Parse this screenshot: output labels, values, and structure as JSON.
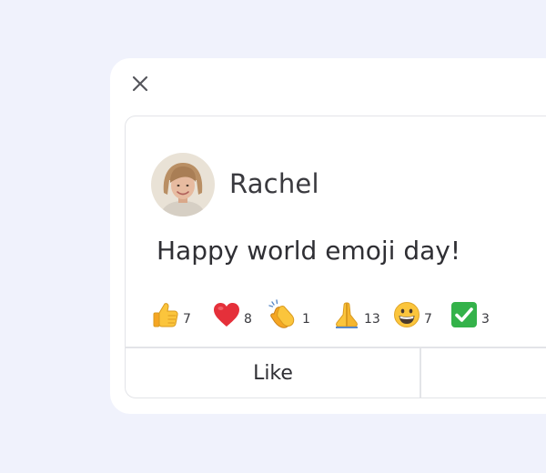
{
  "post": {
    "author": "Rachel",
    "message": "Happy world emoji day!"
  },
  "reactions": [
    {
      "emoji": "thumbs-up",
      "count": "7"
    },
    {
      "emoji": "red-heart",
      "count": "8"
    },
    {
      "emoji": "clapping-hands",
      "count": "1"
    },
    {
      "emoji": "folded-hands",
      "count": "13"
    },
    {
      "emoji": "grinning-face",
      "count": "7"
    },
    {
      "emoji": "check-mark-button",
      "count": "3"
    }
  ],
  "actions": {
    "like_label": "Like",
    "second_label": ""
  },
  "colors": {
    "background": "#f0f2fc",
    "panel": "#ffffff",
    "border": "#e3e4e8",
    "text": "#2f2f34",
    "check_green": "#34b24a",
    "heart_red": "#e5303a",
    "emoji_yellow": "#fbc53c"
  }
}
